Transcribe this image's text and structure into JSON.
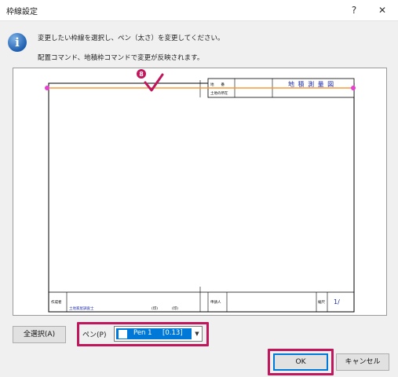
{
  "window": {
    "title": "枠線設定",
    "help_glyph": "?",
    "close_glyph": "✕"
  },
  "message": {
    "icon_glyph": "i",
    "line1": "変更したい枠線を選択し、ペン（太さ）を変更してください。",
    "line2": "配置コマンド、地積枠コマンドで変更が反映されます。"
  },
  "preview": {
    "marker_number": "8",
    "table_row1_left": "地　　番",
    "table_row2_left": "土地の所在",
    "drawing_title": "地 積 測 量 図",
    "bottom_creator": "作成者",
    "bottom_address": "土地家屋調査士",
    "bottom_mid": "(印)　　　　(印)",
    "bottom_applicant": "申請人",
    "bottom_scale": "縮尺",
    "bottom_slash": "1/"
  },
  "controls": {
    "select_all_label": "全選択(A)",
    "pen_label": "ペン(P)",
    "pen_value": "Pen 1     [0.13]",
    "ok_label": "OK",
    "cancel_label": "キャンセル"
  },
  "colors": {
    "highlight": "#c0175c",
    "selection_blue": "#0078d7",
    "selected_line": "#f59a3d",
    "handle": "#e83fd0"
  }
}
